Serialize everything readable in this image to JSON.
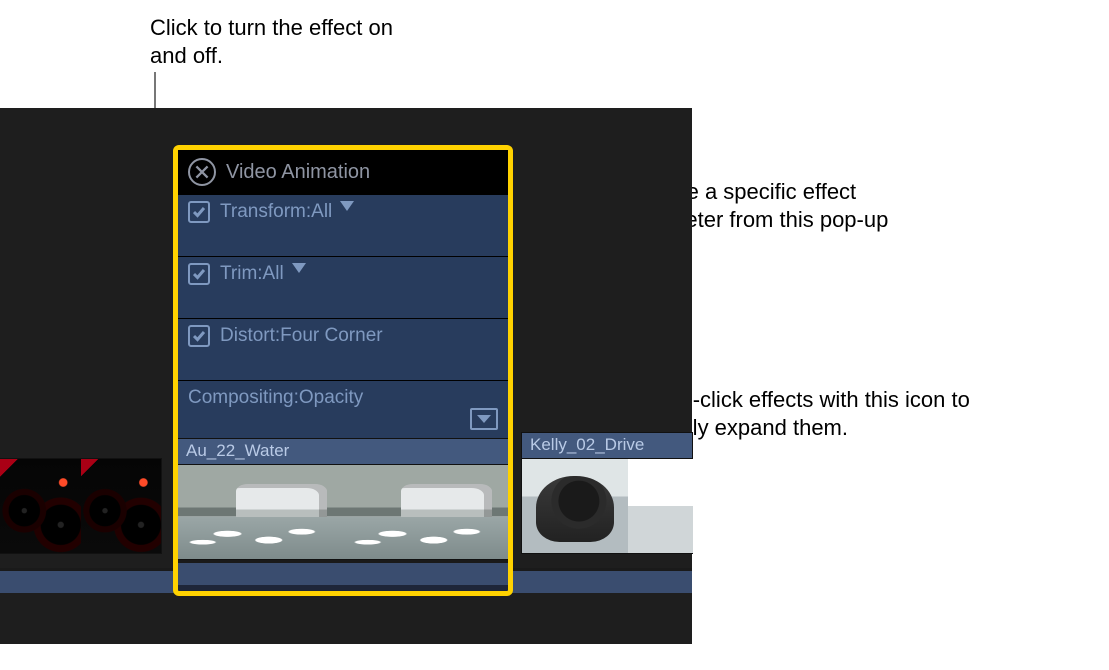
{
  "annotations": {
    "toggle": "Click to turn the effect on and off.",
    "popup": "Choose a specific effect parameter from this pop-up menu.",
    "expand": "Double-click effects with this icon to vertically expand them."
  },
  "panel": {
    "title": "Video Animation",
    "effects": [
      {
        "label": "Transform:All",
        "has_checkbox": true,
        "has_popup": true,
        "has_expand": false
      },
      {
        "label": "Trim:All",
        "has_checkbox": true,
        "has_popup": true,
        "has_expand": false
      },
      {
        "label": "Distort:Four Corner",
        "has_checkbox": true,
        "has_popup": false,
        "has_expand": false
      },
      {
        "label": "Compositing:Opacity",
        "has_checkbox": false,
        "has_popup": false,
        "has_expand": true
      }
    ]
  },
  "clips": [
    {
      "name": "Au_22_Water"
    },
    {
      "name": "Kelly_02_Drive"
    }
  ]
}
